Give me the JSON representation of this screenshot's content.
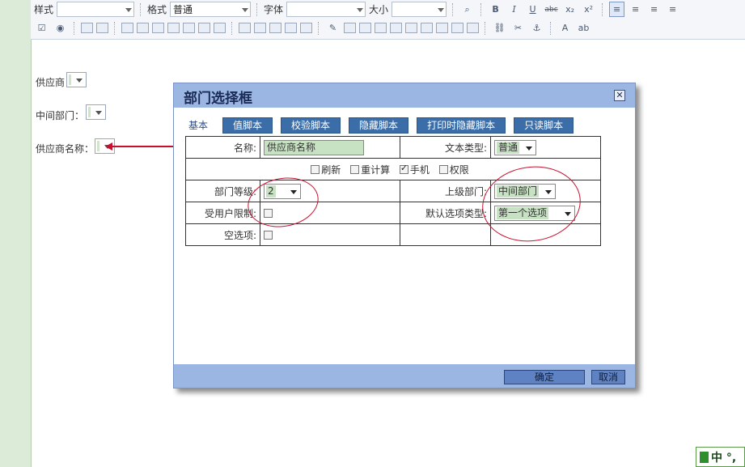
{
  "toolbar": {
    "style_label": "样式",
    "format_label": "格式",
    "format_value": "普通",
    "font_label": "字体",
    "size_label": "大小",
    "bold": "B",
    "italic": "I",
    "underline": "U",
    "strike": "abc",
    "subscript": "x₂",
    "superscript": "x²"
  },
  "page": {
    "field1_label": "供应商",
    "field2_label": "中间部门：",
    "field3_label": "供应商名称："
  },
  "dialog": {
    "title": "部门选择框",
    "close": "✕",
    "tabs": [
      "基本",
      "值脚本",
      "校验脚本",
      "隐藏脚本",
      "打印时隐藏脚本",
      "只读脚本"
    ],
    "name_label": "名称:",
    "name_value": "供应商名称",
    "text_type_label": "文本类型:",
    "text_type_value": "普通",
    "checks": [
      {
        "label": "刷新",
        "checked": false
      },
      {
        "label": "重计算",
        "checked": false
      },
      {
        "label": "手机",
        "checked": true
      },
      {
        "label": "权限",
        "checked": false
      }
    ],
    "dept_level_label": "部门等级:",
    "dept_level_value": "2",
    "parent_dept_label": "上级部门:",
    "parent_dept_value": "中间部门",
    "user_limit_label": "受用户限制:",
    "default_option_label": "默认选项类型:",
    "default_option_value": "第一个选项",
    "empty_option_label": "空选项:",
    "ok_button": "确定",
    "cancel_button": "取消"
  },
  "ime": {
    "text": "中 °,"
  },
  "colors": {
    "accent": "#3b6ea8",
    "dialog_frame": "#9cb6e4",
    "annotation": "#c8102e",
    "input_fill": "#c7e2c2"
  }
}
